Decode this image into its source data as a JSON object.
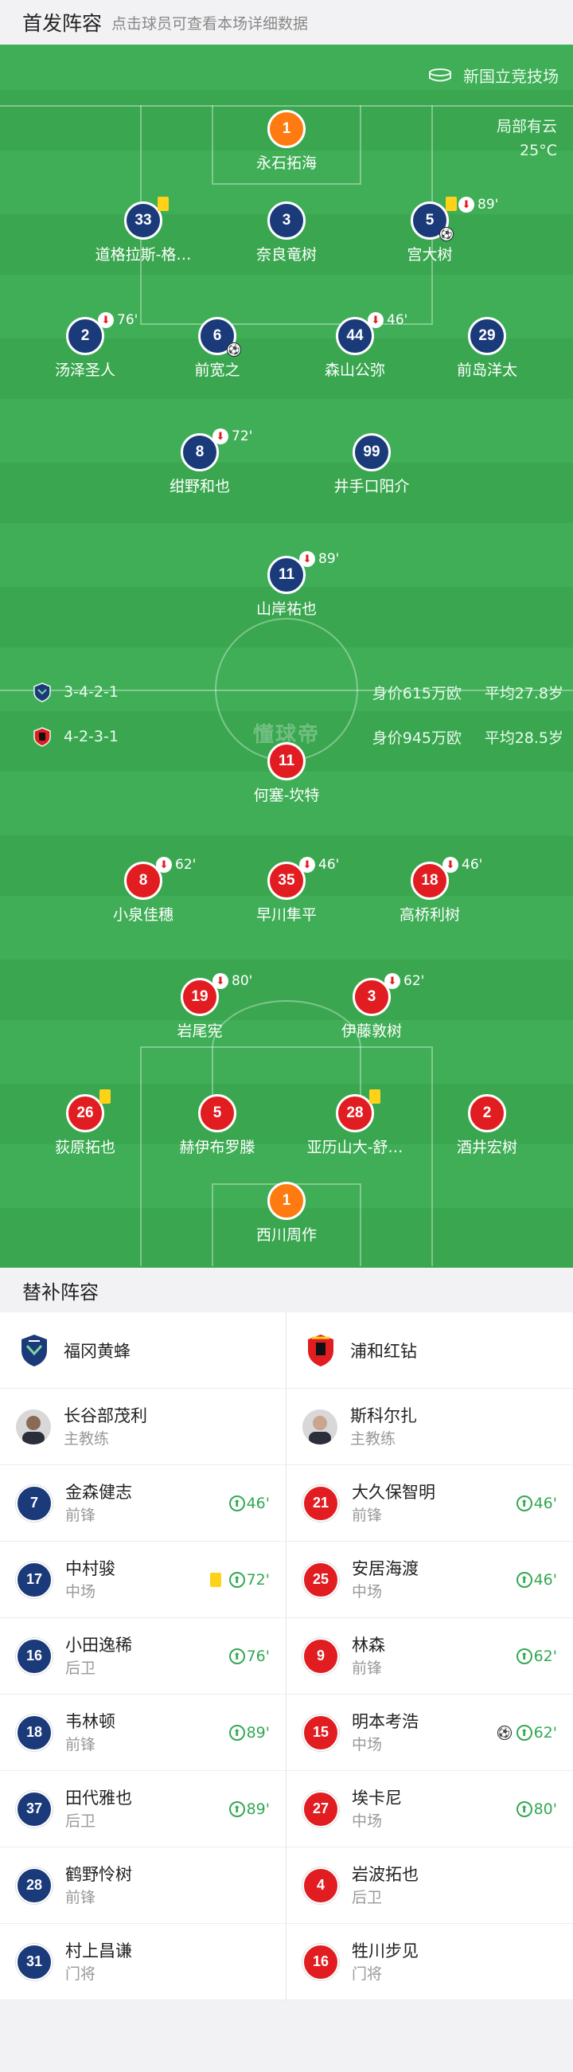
{
  "header": {
    "title": "首发阵容",
    "hint": "点击球员可查看本场详细数据"
  },
  "venue": {
    "icon": "stadium-icon",
    "name": "新国立竞技场"
  },
  "weather": {
    "condition": "局部有云",
    "temp": "25°C"
  },
  "watermark": "懂球帝",
  "home_team": {
    "formation": "3-4-2-1",
    "value": "身价615万欧",
    "avg_age": "平均27.8岁",
    "color": "#1b3a7a"
  },
  "away_team": {
    "formation": "4-2-3-1",
    "value": "身价945万欧",
    "avg_age": "平均28.5岁",
    "color": "#e11d22"
  },
  "home_lineup": [
    {
      "num": "1",
      "name": "永石拓海"
    },
    {
      "num": "33",
      "name": "道格拉斯-格…"
    },
    {
      "num": "3",
      "name": "奈良竜树"
    },
    {
      "num": "5",
      "name": "宫大树",
      "sub": "89'"
    },
    {
      "num": "2",
      "name": "汤泽圣人",
      "sub": "76'"
    },
    {
      "num": "6",
      "name": "前宽之"
    },
    {
      "num": "44",
      "name": "森山公弥",
      "sub": "46'"
    },
    {
      "num": "29",
      "name": "前岛洋太"
    },
    {
      "num": "8",
      "name": "绀野和也",
      "sub": "72'"
    },
    {
      "num": "99",
      "name": "井手口阳介"
    },
    {
      "num": "11",
      "name": "山岸祐也",
      "sub": "89'"
    }
  ],
  "away_lineup": [
    {
      "num": "11",
      "name": "何塞-坎特"
    },
    {
      "num": "8",
      "name": "小泉佳穗",
      "sub": "62'"
    },
    {
      "num": "35",
      "name": "早川隼平",
      "sub": "46'"
    },
    {
      "num": "18",
      "name": "高桥利树",
      "sub": "46'"
    },
    {
      "num": "19",
      "name": "岩尾宪",
      "sub": "80'"
    },
    {
      "num": "3",
      "name": "伊藤敦树",
      "sub": "62'"
    },
    {
      "num": "26",
      "name": "荻原拓也"
    },
    {
      "num": "5",
      "name": "赫伊布罗滕"
    },
    {
      "num": "28",
      "name": "亚历山大-舒…"
    },
    {
      "num": "2",
      "name": "酒井宏树"
    },
    {
      "num": "1",
      "name": "西川周作"
    }
  ],
  "subs_header": "替补阵容",
  "subs": {
    "home": {
      "team": "福冈黄蜂",
      "coach": {
        "name": "长谷部茂利",
        "role": "主教练"
      },
      "players": [
        {
          "num": "7",
          "name": "金森健志",
          "pos": "前锋",
          "on": "46'"
        },
        {
          "num": "17",
          "name": "中村骏",
          "pos": "中场",
          "on": "72'"
        },
        {
          "num": "16",
          "name": "小田逸稀",
          "pos": "后卫",
          "on": "76'"
        },
        {
          "num": "18",
          "name": "韦林顿",
          "pos": "前锋",
          "on": "89'"
        },
        {
          "num": "37",
          "name": "田代雅也",
          "pos": "后卫",
          "on": "89'"
        },
        {
          "num": "28",
          "name": "鹤野怜树",
          "pos": "前锋"
        },
        {
          "num": "31",
          "name": "村上昌谦",
          "pos": "门将"
        }
      ]
    },
    "away": {
      "team": "浦和红钻",
      "coach": {
        "name": "斯科尔扎",
        "role": "主教练"
      },
      "players": [
        {
          "num": "21",
          "name": "大久保智明",
          "pos": "前锋",
          "on": "46'"
        },
        {
          "num": "25",
          "name": "安居海渡",
          "pos": "中场",
          "on": "46'"
        },
        {
          "num": "9",
          "name": "林森",
          "pos": "前锋",
          "on": "62'"
        },
        {
          "num": "15",
          "name": "明本考浩",
          "pos": "中场",
          "on": "62'"
        },
        {
          "num": "27",
          "name": "埃卡尼",
          "pos": "中场",
          "on": "80'"
        },
        {
          "num": "4",
          "name": "岩波拓也",
          "pos": "后卫"
        },
        {
          "num": "16",
          "name": "牲川步见",
          "pos": "门将"
        }
      ]
    }
  }
}
